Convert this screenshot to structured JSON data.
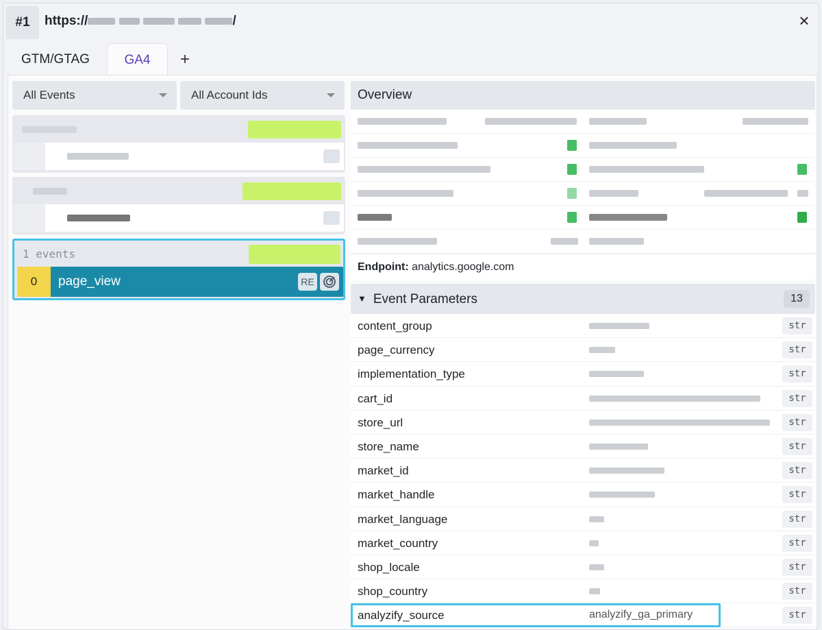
{
  "titlebar": {
    "tab_number": "#1",
    "url_prefix": "https://",
    "url_suffix": "/",
    "close_icon": "close-icon"
  },
  "tabs": [
    {
      "label": "GTM/GTAG",
      "active": false
    },
    {
      "label": "GA4",
      "active": true
    },
    {
      "label": "+",
      "active": false
    }
  ],
  "filters": {
    "events": "All Events",
    "accounts": "All Account Ids"
  },
  "event_group": {
    "count_label": "1 events",
    "event": {
      "index": "0",
      "name": "page_view",
      "re_label": "RE",
      "target_icon": "target-icon"
    }
  },
  "overview": {
    "title": "Overview",
    "endpoint_label": "Endpoint:",
    "endpoint_value": "analytics.google.com"
  },
  "event_parameters": {
    "title": "Event Parameters",
    "count": "13",
    "items": [
      {
        "name": "content_group",
        "type": "str"
      },
      {
        "name": "page_currency",
        "type": "str"
      },
      {
        "name": "implementation_type",
        "type": "str"
      },
      {
        "name": "cart_id",
        "type": "str"
      },
      {
        "name": "store_url",
        "type": "str"
      },
      {
        "name": "store_name",
        "type": "str"
      },
      {
        "name": "market_id",
        "type": "str"
      },
      {
        "name": "market_handle",
        "type": "str"
      },
      {
        "name": "market_language",
        "type": "str"
      },
      {
        "name": "market_country",
        "type": "str"
      },
      {
        "name": "shop_locale",
        "type": "str"
      },
      {
        "name": "shop_country",
        "type": "str"
      },
      {
        "name": "analyzify_source",
        "value": "analyzify_ga_primary",
        "type": "str"
      }
    ]
  },
  "colors": {
    "accent_purple": "#5b3fb8",
    "event_row": "#1a8aa8",
    "index_yellow": "#f3d54b",
    "highlight": "#45c2e6",
    "badge_green": "#c9f26b"
  }
}
